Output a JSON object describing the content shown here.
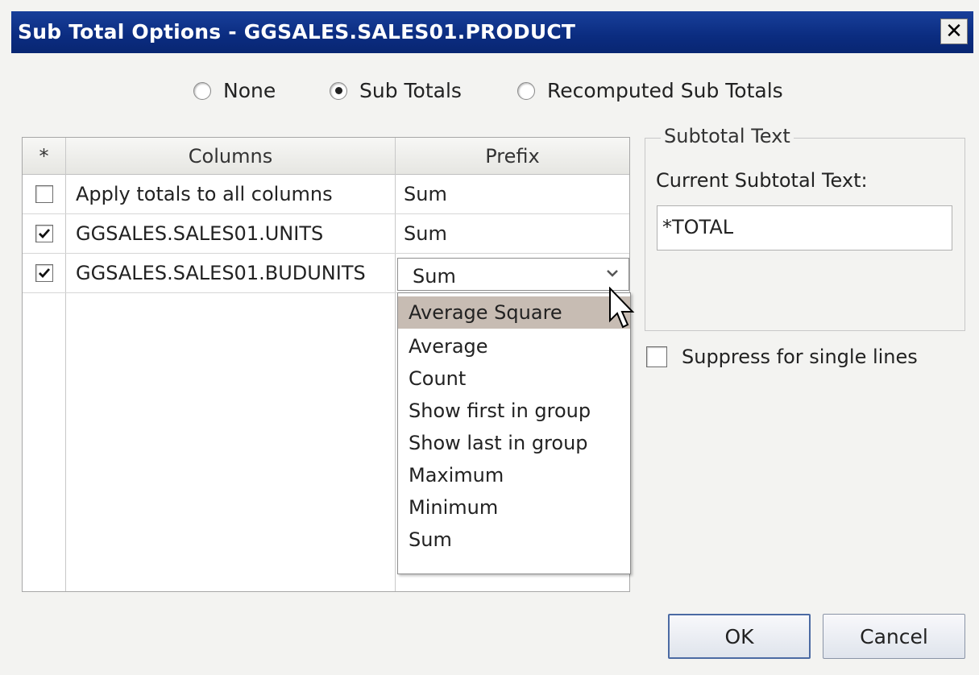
{
  "window": {
    "title": "Sub Total Options - GGSALES.SALES01.PRODUCT",
    "close_label": "✕"
  },
  "mode": {
    "options": [
      {
        "label": "None",
        "selected": false
      },
      {
        "label": "Sub Totals",
        "selected": true
      },
      {
        "label": "Recomputed Sub Totals",
        "selected": false
      }
    ]
  },
  "grid": {
    "headers": {
      "check": "*",
      "columns": "Columns",
      "prefix": "Prefix"
    },
    "rows": [
      {
        "checked": false,
        "column": "Apply totals to all columns",
        "prefix": "Sum"
      },
      {
        "checked": true,
        "column": "GGSALES.SALES01.UNITS",
        "prefix": "Sum"
      },
      {
        "checked": true,
        "column": "GGSALES.SALES01.BUDUNITS",
        "prefix": "Sum"
      }
    ],
    "dropdown_options": [
      "Average Square",
      "Average",
      "Count",
      "Show first in group",
      "Show last in group",
      "Maximum",
      "Minimum",
      "Sum"
    ],
    "dropdown_highlighted": "Average Square"
  },
  "subtotal_text": {
    "legend": "Subtotal Text",
    "label": "Current Subtotal Text:",
    "value": "*TOTAL"
  },
  "suppress": {
    "label": "Suppress for single lines",
    "checked": false
  },
  "buttons": {
    "ok": "OK",
    "cancel": "Cancel"
  },
  "colors": {
    "titlebar": "#0b2c80",
    "highlight": "#c7bcb3"
  }
}
